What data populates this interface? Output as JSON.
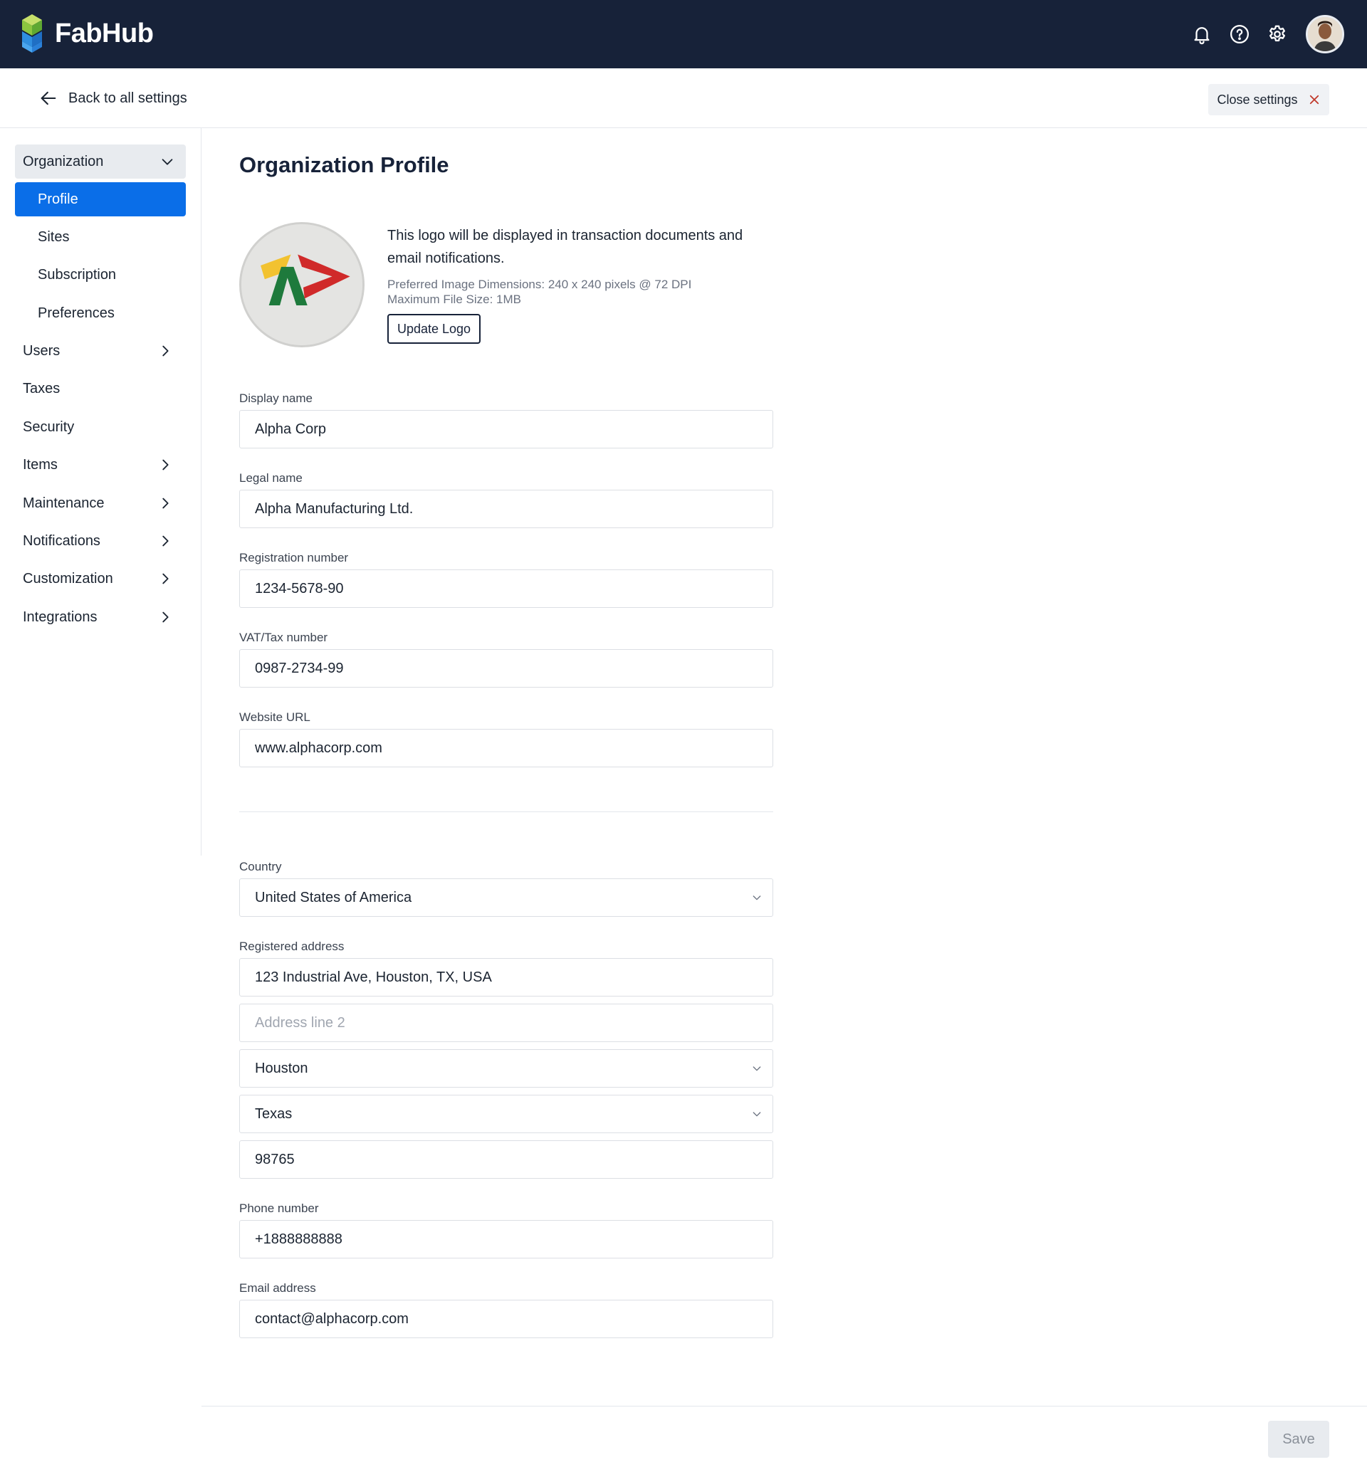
{
  "app": {
    "name": "FabHub",
    "colors": {
      "header_bg": "#172239",
      "accent": "#0a6ee8",
      "brand_green": "#8cc63f",
      "brand_blue": "#2f8fe0"
    }
  },
  "topbar": {
    "icons": [
      "bell-icon",
      "help-icon",
      "gear-icon",
      "avatar"
    ]
  },
  "subheader": {
    "back_label": "Back to all settings",
    "close_label": "Close settings"
  },
  "sidebar": {
    "group": {
      "label": "Organization",
      "expanded": true
    },
    "sub_items": [
      {
        "label": "Profile",
        "active": true
      },
      {
        "label": "Sites",
        "active": false
      },
      {
        "label": "Subscription",
        "active": false
      },
      {
        "label": "Preferences",
        "active": false
      }
    ],
    "items": [
      {
        "label": "Users",
        "has_children": true
      },
      {
        "label": "Taxes",
        "has_children": false
      },
      {
        "label": "Security",
        "has_children": false
      },
      {
        "label": "Items",
        "has_children": true
      },
      {
        "label": "Maintenance",
        "has_children": true
      },
      {
        "label": "Notifications",
        "has_children": true
      },
      {
        "label": "Customization",
        "has_children": true
      },
      {
        "label": "Integrations",
        "has_children": true
      }
    ]
  },
  "main": {
    "title": "Organization Profile",
    "logo": {
      "description": "This logo will be displayed in transaction documents and email notifications.",
      "dimensions_hint": "Preferred Image Dimensions: 240 x 240 pixels @ 72 DPI",
      "size_hint": "Maximum File Size: 1MB",
      "update_label": "Update Logo"
    },
    "fields": {
      "display_name": {
        "label": "Display name",
        "value": "Alpha Corp"
      },
      "legal_name": {
        "label": "Legal name",
        "value": "Alpha Manufacturing Ltd."
      },
      "registration_number": {
        "label": "Registration number",
        "value": "1234-5678-90"
      },
      "vat_number": {
        "label": "VAT/Tax number",
        "value": "0987-2734-99"
      },
      "website": {
        "label": "Website URL",
        "value": "www.alphacorp.com"
      },
      "country": {
        "label": "Country",
        "value": "United States of America"
      },
      "address": {
        "label": "Registered address",
        "line1": "123 Industrial Ave, Houston, TX, USA",
        "line2_placeholder": "Address line 2",
        "city": "Houston",
        "state": "Texas",
        "zip": "98765"
      },
      "phone": {
        "label": "Phone number",
        "value": "+1888888888"
      },
      "email": {
        "label": "Email address",
        "value": "contact@alphacorp.com"
      }
    },
    "save_label": "Save"
  }
}
